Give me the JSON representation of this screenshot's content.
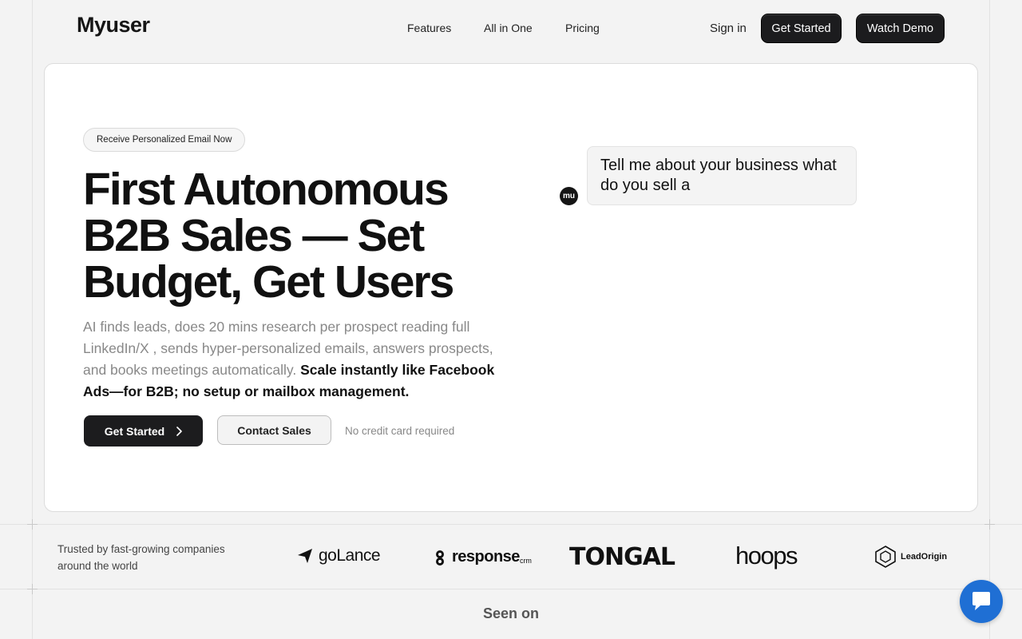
{
  "header": {
    "logo": "Myuser",
    "nav": [
      "Features",
      "All in One",
      "Pricing"
    ],
    "sign_in": "Sign in",
    "get_started": "Get Started",
    "watch_demo": "Watch Demo"
  },
  "hero": {
    "pill": "Receive Personalized Email Now",
    "headline_lines": [
      "First Autonomous",
      "B2B Sales — Set",
      "Budget, Get Users"
    ],
    "description": "AI finds leads, does 20 mins research per prospect reading full LinkedIn/X , sends hyper-personalized emails, answers prospects, and books meetings automatically.",
    "description_bold": "Scale instantly like Facebook Ads—for B2B; no setup or mailbox management.",
    "cta_primary": "Get Started",
    "cta_secondary": "Contact Sales",
    "note": "No credit card required",
    "chat": {
      "avatar": "mu",
      "message": "Tell me about your business what do you sell a"
    }
  },
  "trusted": {
    "text": "Trusted by fast-growing companies around the world",
    "logos": [
      "goLance",
      "response",
      "crm",
      "TONGAL",
      "hoops",
      "LeadOrigin"
    ]
  },
  "seen_on": "Seen on",
  "icons": {
    "chevron": "chevron-right-icon",
    "chat": "chat-bubble-icon"
  }
}
